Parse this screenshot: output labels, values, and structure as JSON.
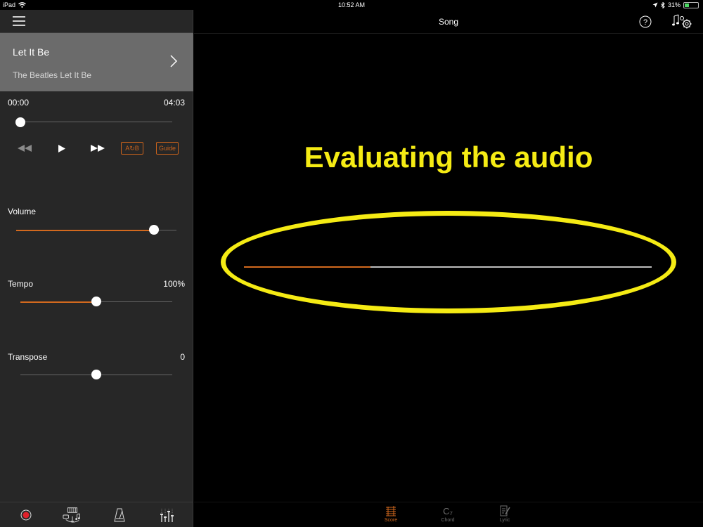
{
  "status_bar": {
    "device": "iPad",
    "time": "10:52 AM",
    "battery": "31%",
    "battery_level": 0.31
  },
  "left_panel": {
    "song": {
      "title": "Let It Be",
      "subtitle": "The Beatles  Let It Be"
    },
    "playback": {
      "time_start": "00:00",
      "time_end": "04:03",
      "position_fraction": 0.0
    },
    "transport": {
      "ab_label": "A↻B",
      "guide_label": "Guide"
    },
    "volume": {
      "label": "Volume",
      "level_fraction": 0.86
    },
    "tempo": {
      "label": "Tempo",
      "value": "100%",
      "level_fraction": 0.5
    },
    "transpose": {
      "label": "Transpose",
      "value": "0",
      "level_fraction": 0.5
    },
    "bottom_icons": [
      "record-icon",
      "song-library-icon",
      "metronome-icon",
      "mixer-icon"
    ]
  },
  "main": {
    "nav_title": "Song",
    "annotation_text": "Evaluating the audio",
    "progress_fraction": 0.31,
    "tabs": [
      {
        "label": "Score",
        "active": true
      },
      {
        "label": "Chord",
        "active": false,
        "icon_text": "C₇"
      },
      {
        "label": "Lyric",
        "active": false
      }
    ]
  },
  "colors": {
    "accent": "#d2691e",
    "annotation": "#f5eb14",
    "panel_bg": "#272727",
    "card_bg": "#6b6b6b"
  }
}
